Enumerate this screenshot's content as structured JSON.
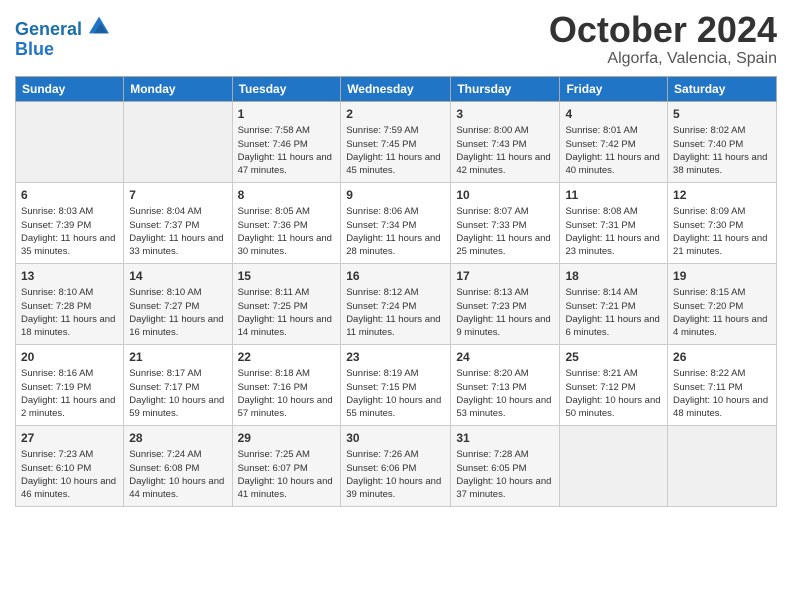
{
  "logo": {
    "line1": "General",
    "line2": "Blue"
  },
  "title": "October 2024",
  "location": "Algorfa, Valencia, Spain",
  "headers": [
    "Sunday",
    "Monday",
    "Tuesday",
    "Wednesday",
    "Thursday",
    "Friday",
    "Saturday"
  ],
  "weeks": [
    [
      {
        "day": "",
        "sunrise": "",
        "sunset": "",
        "daylight": ""
      },
      {
        "day": "",
        "sunrise": "",
        "sunset": "",
        "daylight": ""
      },
      {
        "day": "1",
        "sunrise": "Sunrise: 7:58 AM",
        "sunset": "Sunset: 7:46 PM",
        "daylight": "Daylight: 11 hours and 47 minutes."
      },
      {
        "day": "2",
        "sunrise": "Sunrise: 7:59 AM",
        "sunset": "Sunset: 7:45 PM",
        "daylight": "Daylight: 11 hours and 45 minutes."
      },
      {
        "day": "3",
        "sunrise": "Sunrise: 8:00 AM",
        "sunset": "Sunset: 7:43 PM",
        "daylight": "Daylight: 11 hours and 42 minutes."
      },
      {
        "day": "4",
        "sunrise": "Sunrise: 8:01 AM",
        "sunset": "Sunset: 7:42 PM",
        "daylight": "Daylight: 11 hours and 40 minutes."
      },
      {
        "day": "5",
        "sunrise": "Sunrise: 8:02 AM",
        "sunset": "Sunset: 7:40 PM",
        "daylight": "Daylight: 11 hours and 38 minutes."
      }
    ],
    [
      {
        "day": "6",
        "sunrise": "Sunrise: 8:03 AM",
        "sunset": "Sunset: 7:39 PM",
        "daylight": "Daylight: 11 hours and 35 minutes."
      },
      {
        "day": "7",
        "sunrise": "Sunrise: 8:04 AM",
        "sunset": "Sunset: 7:37 PM",
        "daylight": "Daylight: 11 hours and 33 minutes."
      },
      {
        "day": "8",
        "sunrise": "Sunrise: 8:05 AM",
        "sunset": "Sunset: 7:36 PM",
        "daylight": "Daylight: 11 hours and 30 minutes."
      },
      {
        "day": "9",
        "sunrise": "Sunrise: 8:06 AM",
        "sunset": "Sunset: 7:34 PM",
        "daylight": "Daylight: 11 hours and 28 minutes."
      },
      {
        "day": "10",
        "sunrise": "Sunrise: 8:07 AM",
        "sunset": "Sunset: 7:33 PM",
        "daylight": "Daylight: 11 hours and 25 minutes."
      },
      {
        "day": "11",
        "sunrise": "Sunrise: 8:08 AM",
        "sunset": "Sunset: 7:31 PM",
        "daylight": "Daylight: 11 hours and 23 minutes."
      },
      {
        "day": "12",
        "sunrise": "Sunrise: 8:09 AM",
        "sunset": "Sunset: 7:30 PM",
        "daylight": "Daylight: 11 hours and 21 minutes."
      }
    ],
    [
      {
        "day": "13",
        "sunrise": "Sunrise: 8:10 AM",
        "sunset": "Sunset: 7:28 PM",
        "daylight": "Daylight: 11 hours and 18 minutes."
      },
      {
        "day": "14",
        "sunrise": "Sunrise: 8:10 AM",
        "sunset": "Sunset: 7:27 PM",
        "daylight": "Daylight: 11 hours and 16 minutes."
      },
      {
        "day": "15",
        "sunrise": "Sunrise: 8:11 AM",
        "sunset": "Sunset: 7:25 PM",
        "daylight": "Daylight: 11 hours and 14 minutes."
      },
      {
        "day": "16",
        "sunrise": "Sunrise: 8:12 AM",
        "sunset": "Sunset: 7:24 PM",
        "daylight": "Daylight: 11 hours and 11 minutes."
      },
      {
        "day": "17",
        "sunrise": "Sunrise: 8:13 AM",
        "sunset": "Sunset: 7:23 PM",
        "daylight": "Daylight: 11 hours and 9 minutes."
      },
      {
        "day": "18",
        "sunrise": "Sunrise: 8:14 AM",
        "sunset": "Sunset: 7:21 PM",
        "daylight": "Daylight: 11 hours and 6 minutes."
      },
      {
        "day": "19",
        "sunrise": "Sunrise: 8:15 AM",
        "sunset": "Sunset: 7:20 PM",
        "daylight": "Daylight: 11 hours and 4 minutes."
      }
    ],
    [
      {
        "day": "20",
        "sunrise": "Sunrise: 8:16 AM",
        "sunset": "Sunset: 7:19 PM",
        "daylight": "Daylight: 11 hours and 2 minutes."
      },
      {
        "day": "21",
        "sunrise": "Sunrise: 8:17 AM",
        "sunset": "Sunset: 7:17 PM",
        "daylight": "Daylight: 10 hours and 59 minutes."
      },
      {
        "day": "22",
        "sunrise": "Sunrise: 8:18 AM",
        "sunset": "Sunset: 7:16 PM",
        "daylight": "Daylight: 10 hours and 57 minutes."
      },
      {
        "day": "23",
        "sunrise": "Sunrise: 8:19 AM",
        "sunset": "Sunset: 7:15 PM",
        "daylight": "Daylight: 10 hours and 55 minutes."
      },
      {
        "day": "24",
        "sunrise": "Sunrise: 8:20 AM",
        "sunset": "Sunset: 7:13 PM",
        "daylight": "Daylight: 10 hours and 53 minutes."
      },
      {
        "day": "25",
        "sunrise": "Sunrise: 8:21 AM",
        "sunset": "Sunset: 7:12 PM",
        "daylight": "Daylight: 10 hours and 50 minutes."
      },
      {
        "day": "26",
        "sunrise": "Sunrise: 8:22 AM",
        "sunset": "Sunset: 7:11 PM",
        "daylight": "Daylight: 10 hours and 48 minutes."
      }
    ],
    [
      {
        "day": "27",
        "sunrise": "Sunrise: 7:23 AM",
        "sunset": "Sunset: 6:10 PM",
        "daylight": "Daylight: 10 hours and 46 minutes."
      },
      {
        "day": "28",
        "sunrise": "Sunrise: 7:24 AM",
        "sunset": "Sunset: 6:08 PM",
        "daylight": "Daylight: 10 hours and 44 minutes."
      },
      {
        "day": "29",
        "sunrise": "Sunrise: 7:25 AM",
        "sunset": "Sunset: 6:07 PM",
        "daylight": "Daylight: 10 hours and 41 minutes."
      },
      {
        "day": "30",
        "sunrise": "Sunrise: 7:26 AM",
        "sunset": "Sunset: 6:06 PM",
        "daylight": "Daylight: 10 hours and 39 minutes."
      },
      {
        "day": "31",
        "sunrise": "Sunrise: 7:28 AM",
        "sunset": "Sunset: 6:05 PM",
        "daylight": "Daylight: 10 hours and 37 minutes."
      },
      {
        "day": "",
        "sunrise": "",
        "sunset": "",
        "daylight": ""
      },
      {
        "day": "",
        "sunrise": "",
        "sunset": "",
        "daylight": ""
      }
    ]
  ]
}
